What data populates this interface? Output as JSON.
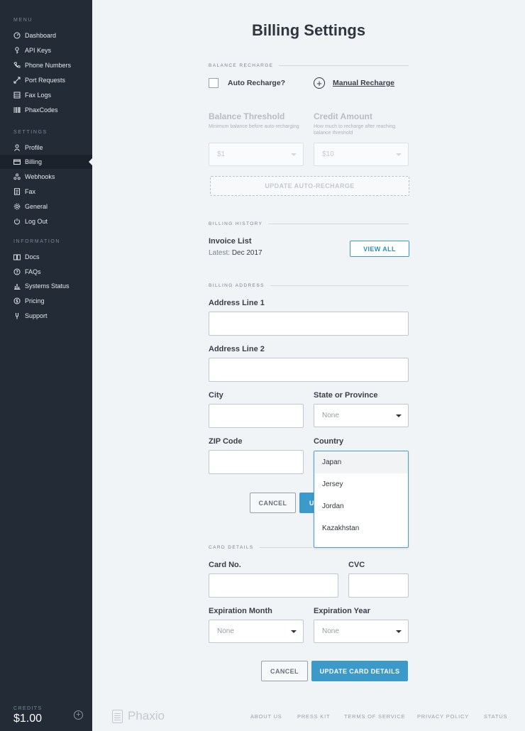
{
  "sidebar": {
    "sections": {
      "menu": "MENU",
      "settings": "SETTINGS",
      "information": "INFORMATION"
    },
    "menu_items": [
      {
        "label": "Dashboard",
        "icon": "dashboard-icon"
      },
      {
        "label": "API Keys",
        "icon": "key-icon"
      },
      {
        "label": "Phone Numbers",
        "icon": "phone-icon"
      },
      {
        "label": "Port Requests",
        "icon": "port-arrows-icon"
      },
      {
        "label": "Fax Logs",
        "icon": "list-icon"
      },
      {
        "label": "PhaxCodes",
        "icon": "barcode-icon"
      }
    ],
    "settings_items": [
      {
        "label": "Profile",
        "icon": "user-icon"
      },
      {
        "label": "Billing",
        "icon": "credit-card-icon",
        "active": true
      },
      {
        "label": "Webhooks",
        "icon": "webhook-icon"
      },
      {
        "label": "Fax",
        "icon": "document-icon"
      },
      {
        "label": "General",
        "icon": "gear-icon"
      },
      {
        "label": "Log Out",
        "icon": "power-icon"
      }
    ],
    "information_items": [
      {
        "label": "Docs",
        "icon": "book-icon"
      },
      {
        "label": "FAQs",
        "icon": "question-icon"
      },
      {
        "label": "Systems Status",
        "icon": "bar-chart-icon"
      },
      {
        "label": "Pricing",
        "icon": "dollar-icon"
      },
      {
        "label": "Support",
        "icon": "support-icon"
      }
    ],
    "credits_label": "CREDITS",
    "credits_value": "$1.00"
  },
  "page": {
    "title": "Billing Settings"
  },
  "balance_recharge": {
    "section_label": "BALANCE RECHARGE",
    "auto_recharge_label": "Auto Recharge?",
    "manual_recharge_label": "Manual Recharge",
    "threshold_label": "Balance Threshold",
    "threshold_help": "Minimum balance before auto-recharging",
    "threshold_value": "$1",
    "credit_label": "Credit Amount",
    "credit_help": "How much to recharge after reaching balance threshold",
    "credit_value": "$10",
    "update_button": "UPDATE AUTO-RECHARGE"
  },
  "billing_history": {
    "section_label": "BILLING HISTORY",
    "invoice_title": "Invoice List",
    "latest_prefix": "Latest:",
    "latest_value": "Dec 2017",
    "view_all_button": "VIEW ALL"
  },
  "billing_address": {
    "section_label": "BILLING ADDRESS",
    "address1_label": "Address Line 1",
    "address1_value": "",
    "address2_label": "Address Line 2",
    "address2_value": "",
    "city_label": "City",
    "city_value": "",
    "state_label": "State or Province",
    "state_value": "None",
    "zip_label": "ZIP Code",
    "zip_value": "",
    "country_label": "Country",
    "country_options": [
      "Japan",
      "Jersey",
      "Jordan",
      "Kazakhstan"
    ],
    "cancel_button": "CANCEL",
    "update_button_partial": "U"
  },
  "card_details": {
    "section_label": "CARD DETAILS",
    "card_no_label": "Card No.",
    "card_no_value": "",
    "cvc_label": "CVC",
    "cvc_value": "",
    "exp_month_label": "Expiration Month",
    "exp_month_value": "None",
    "exp_year_label": "Expiration Year",
    "exp_year_value": "None",
    "cancel_button": "CANCEL",
    "update_button": "UPDATE CARD DETAILS"
  },
  "footer": {
    "logo_text": "Phaxio",
    "links": [
      "ABOUT US",
      "PRESS KIT",
      "TERMS OF SERVICE",
      "PRIVACY POLICY",
      "STATUS"
    ]
  }
}
